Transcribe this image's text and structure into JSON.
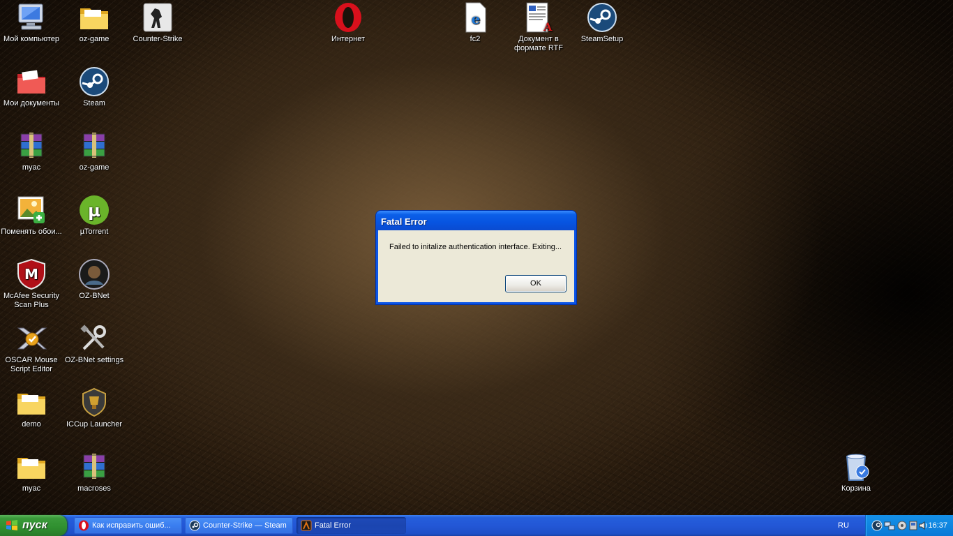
{
  "desktop": {
    "icons": [
      {
        "label": "Мой компьютер"
      },
      {
        "label": "oz-game"
      },
      {
        "label": "Counter-Strike"
      },
      {
        "label": "Интернет"
      },
      {
        "label": "fc2"
      },
      {
        "label": "Документ в формате RTF"
      },
      {
        "label": "SteamSetup"
      },
      {
        "label": "Мои документы"
      },
      {
        "label": "Steam"
      },
      {
        "label": "myac"
      },
      {
        "label": "oz-game"
      },
      {
        "label": "Поменять обои..."
      },
      {
        "label": "µTorrent"
      },
      {
        "label": "McAfee Security Scan Plus"
      },
      {
        "label": "OZ-BNet"
      },
      {
        "label": "OSCAR Mouse Script Editor"
      },
      {
        "label": "OZ-BNet settings"
      },
      {
        "label": "demo"
      },
      {
        "label": "ICCup Launcher"
      },
      {
        "label": "myac"
      },
      {
        "label": "macroses"
      },
      {
        "label": "Корзина"
      }
    ]
  },
  "dialog": {
    "title": "Fatal Error",
    "message": "Failed to initalize authentication interface. Exiting...",
    "ok_label": "OK"
  },
  "taskbar": {
    "start_label": "пуск",
    "tasks": [
      {
        "label": "Как исправить ошиб..."
      },
      {
        "label": "Counter-Strike — Steam"
      },
      {
        "label": "Fatal Error"
      }
    ],
    "language": "RU",
    "clock": "16:37"
  },
  "colors": {
    "taskbar_blue": "#245edb",
    "start_green": "#3a9a3a",
    "dialog_title_blue": "#0754e0",
    "dialog_face": "#ece9d8"
  }
}
